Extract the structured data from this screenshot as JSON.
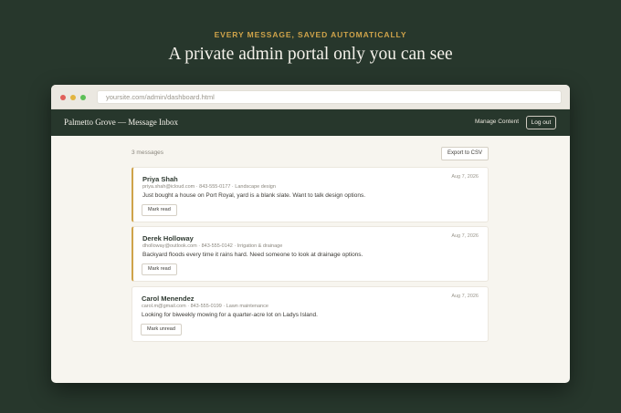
{
  "hero": {
    "eyebrow": "EVERY MESSAGE, SAVED AUTOMATICALLY",
    "headline": "A private admin portal only you can see"
  },
  "browser": {
    "url": "yoursite.com/admin/dashboard.html"
  },
  "appbar": {
    "brand": "Palmetto Grove — Message Inbox",
    "manage_label": "Manage Content",
    "logout_label": "Log out"
  },
  "inbox": {
    "count_label": "3 messages",
    "export_label": "Export to CSV",
    "messages": [
      {
        "name": "Priya Shah",
        "date": "Aug 7, 2026",
        "meta": "priya.shah@icloud.com · 843-555-0177 · Landscape design",
        "body": "Just bought a house on Port Royal, yard is a blank slate. Want to talk design options.",
        "action": "Mark read",
        "unread": true
      },
      {
        "name": "Derek Holloway",
        "date": "Aug 7, 2026",
        "meta": "dholloway@outlook.com · 843-555-0142 · Irrigation & drainage",
        "body": "Backyard floods every time it rains hard. Need someone to look at drainage options.",
        "action": "Mark read",
        "unread": true
      },
      {
        "name": "Carol Menendez",
        "date": "Aug 7, 2026",
        "meta": "carol.m@gmail.com · 843-555-0199 · Lawn maintenance",
        "body": "Looking for biweekly mowing for a quarter-acre lot on Ladys Island.",
        "action": "Mark unread",
        "unread": false
      }
    ]
  },
  "colors": {
    "background": "#27372c",
    "accent": "#cfa34a",
    "window": "#f7f5ef"
  }
}
